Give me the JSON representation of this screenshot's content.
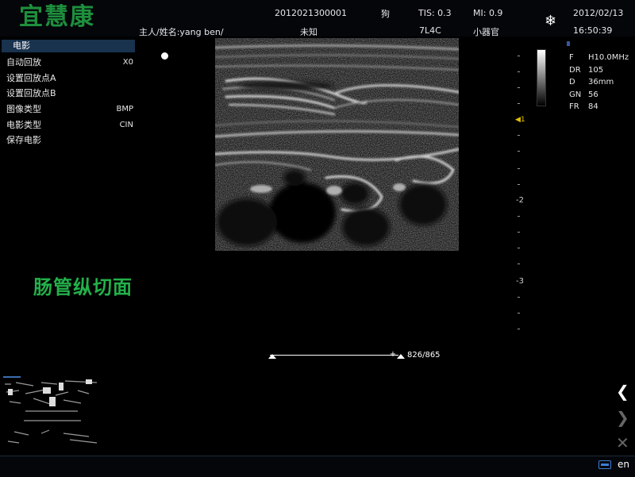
{
  "header": {
    "logo": "宜慧康",
    "patient_id": "2012021300001",
    "owner_name": "主人/姓名:yang ben/",
    "species": "狗",
    "species_detail": "未知",
    "tis": "TIS: 0.3",
    "mi": "MI: 0.9",
    "probe": "7L4C",
    "preset": "小器官",
    "date": "2012/02/13",
    "time": "16:50:39",
    "freeze_icon": "snowflake-icon"
  },
  "menu": {
    "title": "电影",
    "items": [
      {
        "label": "自动回放",
        "value": "X0"
      },
      {
        "label": "设置回放点A",
        "value": ""
      },
      {
        "label": "设置回放点B",
        "value": ""
      },
      {
        "label": "图像类型",
        "value": "BMP"
      },
      {
        "label": "电影类型",
        "value": "CIN"
      },
      {
        "label": "保存电影",
        "value": ""
      }
    ]
  },
  "depth_scale": {
    "labels": [
      "1",
      "-2",
      "-3"
    ],
    "focus_marker": "◀1"
  },
  "params": [
    {
      "key": "F",
      "value": "H10.0MHz"
    },
    {
      "key": "DR",
      "value": "105"
    },
    {
      "key": "D",
      "value": "36mm"
    },
    {
      "key": "GN",
      "value": "56"
    },
    {
      "key": "FR",
      "value": "84"
    }
  ],
  "annotation": "肠管纵切面",
  "cine": {
    "marker": "+",
    "frame_counter": "826/865",
    "position": 0.955
  },
  "nav": {
    "back_icon": "chevron-left-icon",
    "next_icon": "chevron-right-icon",
    "close_icon": "close-icon",
    "back": "❮",
    "next": "❯",
    "close": "✕"
  },
  "status": {
    "keyboard_icon": "keyboard-icon",
    "lang": "en"
  },
  "colors": {
    "logo": "#1e8f3c",
    "annotation": "#23b04a",
    "menu_title_bg": "#19324e",
    "focus_marker": "#e0c000"
  }
}
